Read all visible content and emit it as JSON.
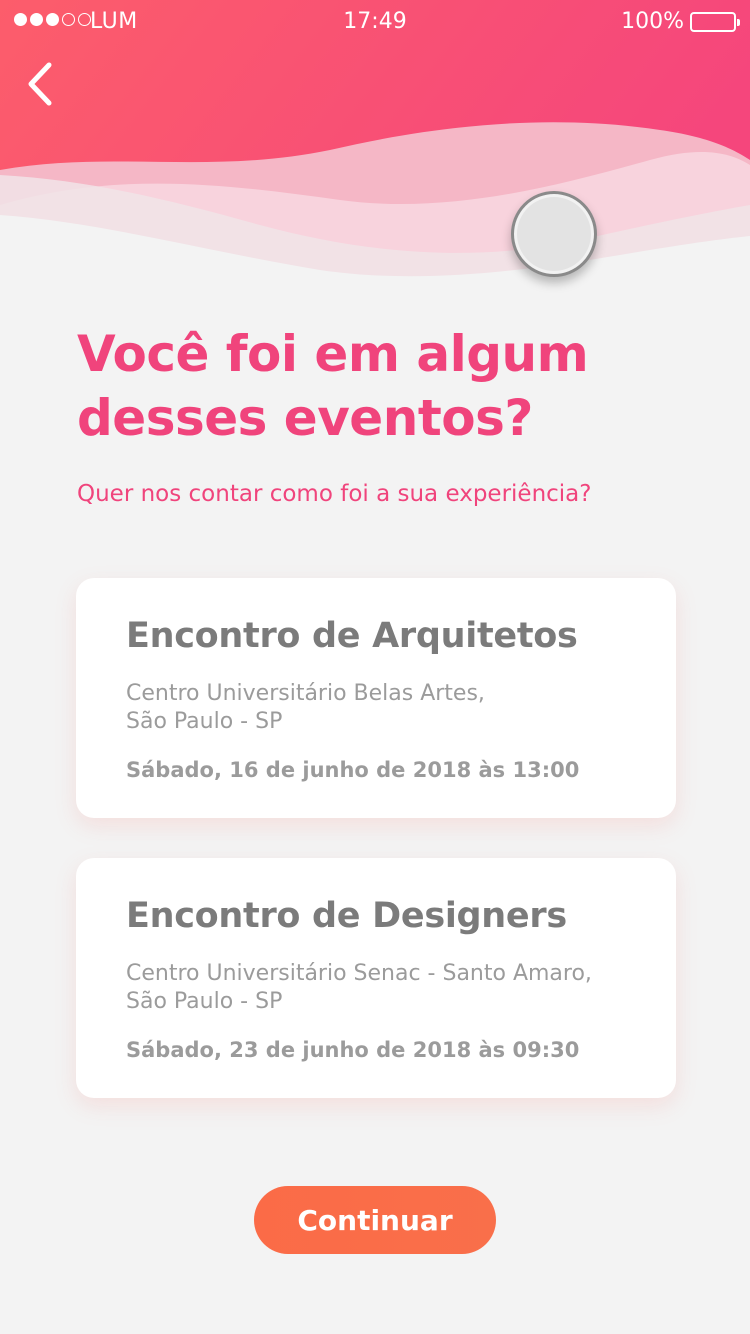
{
  "status_bar": {
    "carrier": "LUM",
    "time": "17:49",
    "battery": "100%",
    "signal_bars_filled": 3,
    "signal_bars_total": 5
  },
  "header": {
    "back_icon": "chevron-left-icon"
  },
  "main": {
    "title": "Você foi em algum desses eventos?",
    "subtitle": "Quer nos contar como foi a sua experiência?"
  },
  "events": [
    {
      "title": "Encontro de Arquitetos",
      "venue_line1": "Centro Universitário Belas Artes,",
      "venue_line2": "São Paulo - SP",
      "date": "Sábado, 16 de junho de 2018 às 13:00"
    },
    {
      "title": "Encontro de Designers",
      "venue_line1": "Centro Universitário Senac - Santo Amaro,",
      "venue_line2": "São Paulo - SP",
      "date": "Sábado, 23 de junho de 2018 às 09:30"
    }
  ],
  "footer": {
    "continue_label": "Continuar"
  },
  "colors": {
    "brand_pink": "#f0447c",
    "gradient_start": "#fc5d6b",
    "gradient_end": "#f5487c",
    "button_orange": "#fb6b47",
    "card_title": "#7b7b7b",
    "card_text": "#9b9b9b",
    "background": "#f3f3f3"
  }
}
